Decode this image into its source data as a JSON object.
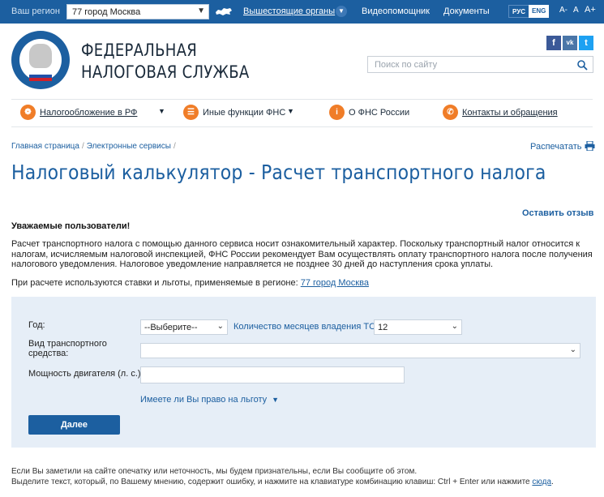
{
  "topbar": {
    "region_label": "Ваш регион",
    "region_value": "77 город Москва",
    "links": [
      "Вышестоящие органы",
      "Видеопомощник",
      "Документы"
    ],
    "lang_ru": "РУС",
    "lang_en": "ENG",
    "font_small": "A-",
    "font_normal": "A",
    "font_large": "A+"
  },
  "header": {
    "brand_line1": "ФЕДЕРАЛЬНАЯ",
    "brand_line2": "НАЛОГОВАЯ СЛУЖБА",
    "search_placeholder": "Поиск по сайту",
    "social": [
      "f",
      "vk",
      "t"
    ]
  },
  "nav": {
    "items": [
      {
        "label": "Налогообложение в РФ",
        "icon": "coat-of-arms-icon"
      },
      {
        "label": "Иные функции ФНС",
        "icon": "menu-icon"
      },
      {
        "label": "О ФНС России",
        "icon": "info-icon"
      },
      {
        "label": "Контакты и обращения",
        "icon": "phone-icon"
      }
    ]
  },
  "breadcrumb": {
    "items": [
      "Главная страница",
      "Электронные сервисы"
    ],
    "print_label": "Распечатать"
  },
  "page": {
    "title": "Налоговый калькулятор - Расчет транспортного налога",
    "feedback": "Оставить отзыв",
    "notice_title": "Уважаемые пользователи!",
    "notice_text": "Расчет транспортного налога с помощью данного сервиса носит ознакомительный характер. Поскольку транспортный налог относится к налогам, исчисляемым налоговой инспекцией, ФНС России рекомендует Вам осуществлять оплату транспортного налога после получения налогового уведомления. Налоговое уведомление направляется не позднее 30 дней до наступления срока уплаты.",
    "region_text": "При расчете используются ставки и льготы, применяемые в регионе:",
    "region_link": "77 город Москва"
  },
  "form": {
    "year_label": "Год:",
    "year_value": "--Выберите--",
    "months_label": "Количество месяцев владения ТС:",
    "months_value": "12",
    "vehicle_label": "Вид транспортного средства:",
    "vehicle_value": "",
    "power_label": "Мощность двигателя (л. с.):",
    "power_value": "",
    "benefit_link": "Имеете ли Вы право на льготу",
    "next_button": "Далее"
  },
  "footer": {
    "line1": "Если Вы заметили на сайте опечатку или неточность, мы будем признательны, если Вы сообщите об этом.",
    "line2": "Выделите текст, который, по Вашему мнению, содержит ошибку, и нажмите на клавиатуре комбинацию клавиш: Ctrl + Enter или нажмите",
    "link": "сюда",
    "end": "."
  },
  "colors": {
    "brand_blue": "#1c5fa0",
    "accent_orange": "#f07d28",
    "panel_bg": "#e6eef7"
  }
}
